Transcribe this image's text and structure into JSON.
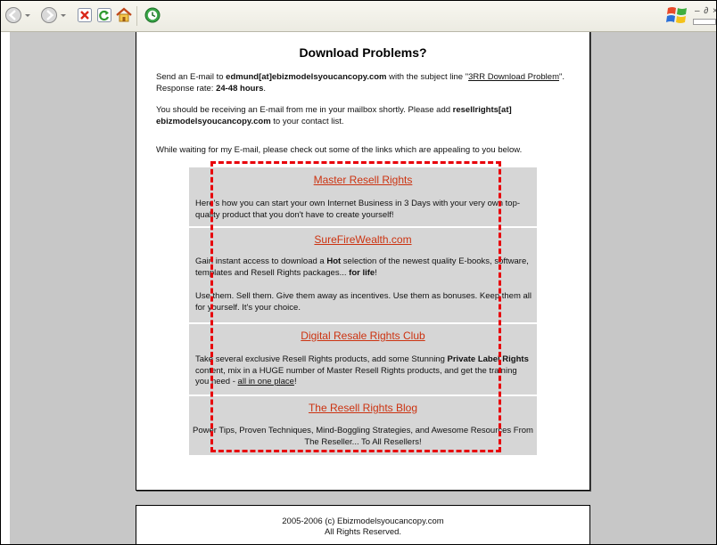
{
  "browser": {
    "windows_controls": "– ∂ ×"
  },
  "page": {
    "title": "Download Problems?",
    "para1": {
      "a": "Send an E-mail to ",
      "email": "edmund[at]ebizmodelsyoucancopy.com",
      "b": " with the subject line \"",
      "subject": "3RR Download Problem",
      "c": "\". Response rate: ",
      "rate": "24-48 hours",
      "d": "."
    },
    "para2": {
      "a": "You should be receiving an E-mail from me in your mailbox shortly. Please add ",
      "email": "resellrights[at] ebizmodelsyoucancopy.com",
      "b": " to your contact list."
    },
    "para3": "While waiting for my E-mail, please check out some of the links which are appealing to you below.",
    "sections": [
      {
        "link": "Master Resell Rights",
        "desc": "Here's how you can start your own Internet Business in 3 Days with your very own top-quality product that you don't have to create yourself!"
      },
      {
        "link": "SureFireWealth.com",
        "desc_a": "Gain instant access to download a ",
        "desc_hot": "Hot",
        "desc_b": " selection of the newest quality E-books, software, templates and Resell Rights packages... ",
        "desc_life": "for life",
        "desc_c": "!",
        "desc2": "Use them. Sell them. Give them away as incentives. Use them as bonuses. Keep them all for yourself. It's your choice."
      },
      {
        "link": "Digital Resale Rights Club",
        "desc_a": "Take several exclusive Resell Rights products, add some Stunning ",
        "desc_plr": "Private Label Rights",
        "desc_b": " content, mix in a HUGE number of Master Resell Rights products, and get the training you need - ",
        "desc_all": "all in one place",
        "desc_c": "!"
      },
      {
        "link": "The Resell Rights Blog",
        "desc": "Power Tips, Proven Techniques, Mind-Boggling Strategies, and Awesome Resources From The Reseller... To All Resellers!"
      }
    ]
  },
  "footer": {
    "line1": "2005-2006 (c) Ebizmodelsyoucancopy.com",
    "line2": "All Rights Reserved."
  },
  "colors": {
    "link": "#cc3311",
    "highlight_dash": "#e8000a",
    "viewport_bg": "#c7c7c7",
    "box_bg": "#d6d6d6"
  }
}
